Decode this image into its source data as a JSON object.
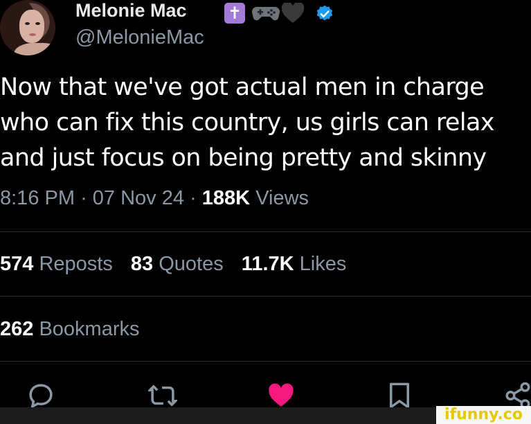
{
  "tweet": {
    "author_name": "Melonie Mac",
    "author_emojis": [
      "latin-cross-emoji",
      "video-game-emoji",
      "black-heart-emoji"
    ],
    "handle": "@MelonieMac",
    "verified": true,
    "text_lines": [
      "Now that we've got actual men in charge",
      "who can fix this country, us girls can relax",
      "and just focus on being pretty and skinny"
    ],
    "time": "8:16 PM",
    "separator": "·",
    "date": "07 Nov 24",
    "views_count": "188K",
    "views_label": "Views"
  },
  "stats": {
    "reposts_count": "574",
    "reposts_label": "Reposts",
    "quotes_count": "83",
    "quotes_label": "Quotes",
    "likes_count": "11.7K",
    "likes_label": "Likes",
    "bookmarks_count": "262",
    "bookmarks_label": "Bookmarks"
  },
  "actions": [
    "reply-icon",
    "repost-icon",
    "like-icon",
    "bookmark-icon",
    "share-icon"
  ],
  "colors": {
    "background": "#000000",
    "text": "#e7e9ea",
    "muted": "#8b98a5",
    "liked": "#f91880",
    "verified": "#1d9bf0"
  },
  "watermark": "ifunny.co"
}
